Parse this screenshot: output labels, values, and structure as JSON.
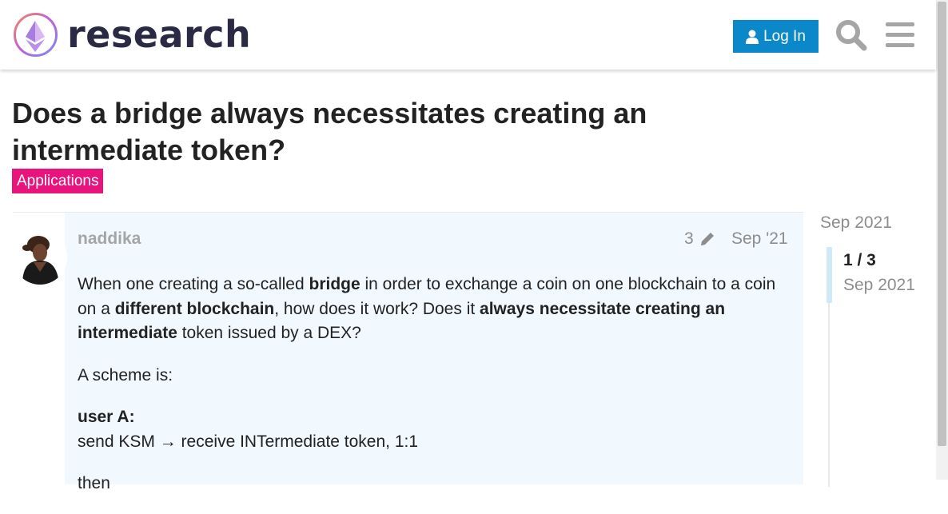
{
  "header": {
    "site_name": "research",
    "login_label": "Log In"
  },
  "topic": {
    "title": "Does a bridge always necessitates creating an intermediate token?",
    "category": "Applications",
    "category_color": "#e8137c"
  },
  "post": {
    "username": "naddika",
    "edit_count": "3",
    "date": "Sep '21",
    "p1_a": "When one creating a so-called ",
    "p1_b": "bridge",
    "p1_c": " in order to exchange a coin on one blockchain to a coin on a ",
    "p1_d": "different blockchain",
    "p1_e": ", how does it work? Does it ",
    "p1_f": "always necessitate creating an intermediate",
    "p1_g": " token issued by a DEX?",
    "p2": "A scheme is:",
    "p3_heading": "user A:",
    "p3_line": "send KSM → receive INTermediate token, 1:1",
    "p4": "then"
  },
  "timeline": {
    "start_date": "Sep 2021",
    "position": "1 / 3",
    "current_date": "Sep 2021"
  },
  "icons": {
    "user": "user-icon",
    "search": "search-icon",
    "menu": "hamburger-menu-icon",
    "edit": "pencil-icon"
  },
  "colors": {
    "accent": "#0a88c9",
    "post_background": "#f1f8fe"
  }
}
